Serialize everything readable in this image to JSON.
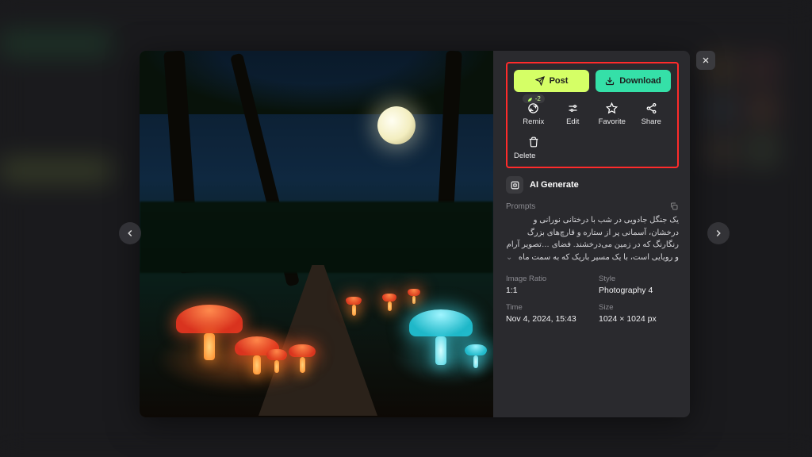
{
  "buttons": {
    "post": "Post",
    "download": "Download"
  },
  "actions": {
    "remix": "Remix",
    "remix_cost": "-2",
    "edit": "Edit",
    "favorite": "Favorite",
    "share": "Share",
    "delete": "Delete"
  },
  "generator": {
    "label": "AI Generate"
  },
  "prompts": {
    "header": "Prompts",
    "text": "یک جنگل جادویی در شب با درختانی نورانی و درخشان، آسمانی پر از\nستاره و قارچ‌های بزرگ رنگارنگ که در زمین می‌درخشند. فضای\n…تصویر آرام و رویایی است، با یک مسیر باریک که به سمت ماه"
  },
  "meta": {
    "ratio_k": "Image Ratio",
    "ratio_v": "1:1",
    "style_k": "Style",
    "style_v": "Photography 4",
    "time_k": "Time",
    "time_v": "Nov 4, 2024, 15:43",
    "size_k": "Size",
    "size_v": "1024 × 1024 px"
  }
}
